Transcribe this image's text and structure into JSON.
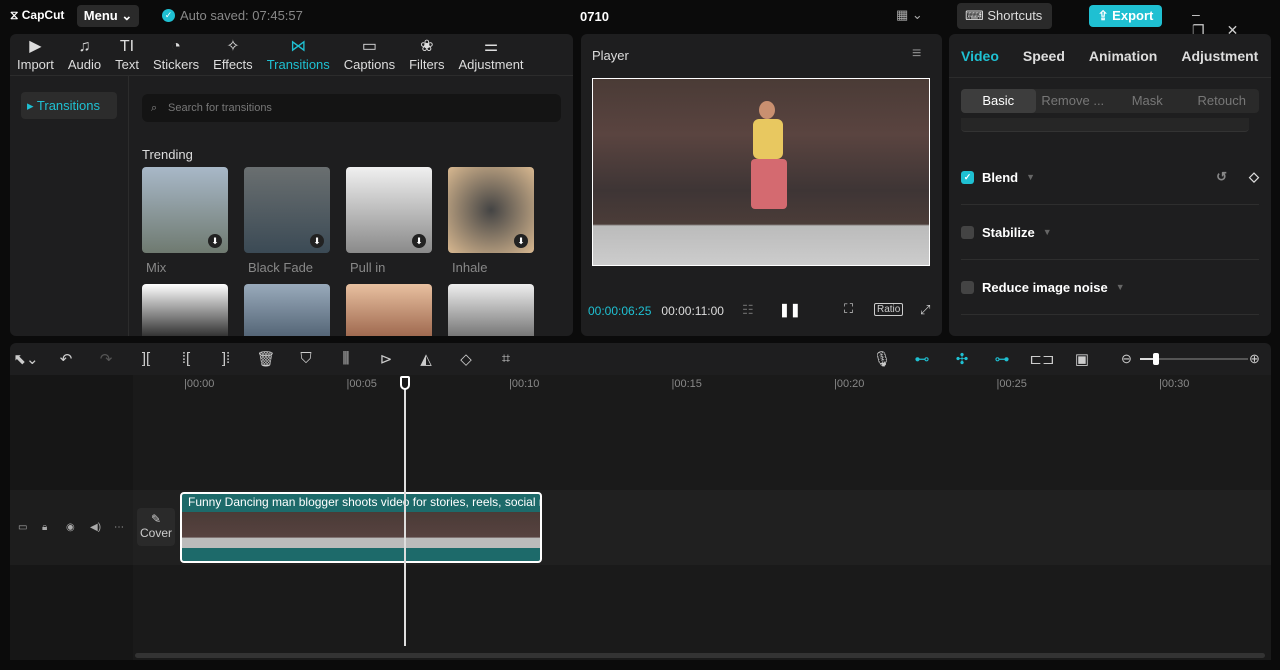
{
  "app": {
    "logo": "CapCut",
    "menu": "Menu",
    "autosave": "Auto saved: 07:45:57",
    "title": "0710",
    "shortcuts": "Shortcuts",
    "export": "Export"
  },
  "toolbar": [
    {
      "label": "Import",
      "icon": "▶"
    },
    {
      "label": "Audio",
      "icon": "♫"
    },
    {
      "label": "Text",
      "icon": "TI"
    },
    {
      "label": "Stickers",
      "icon": "◔"
    },
    {
      "label": "Effects",
      "icon": "✧"
    },
    {
      "label": "Transitions",
      "icon": "⋈"
    },
    {
      "label": "Captions",
      "icon": "▭"
    },
    {
      "label": "Filters",
      "icon": "❀"
    },
    {
      "label": "Adjustment",
      "icon": "⚌"
    }
  ],
  "sidebar": {
    "item": "Transitions"
  },
  "search": {
    "placeholder": "Search for transitions"
  },
  "trending": {
    "heading": "Trending",
    "items": [
      "Mix",
      "Black Fade",
      "Pull in",
      "Inhale"
    ]
  },
  "player": {
    "title": "Player",
    "current": "00:00:06:25",
    "total": "00:00:11:00",
    "ratio": "Ratio"
  },
  "right": {
    "tabs": [
      "Video",
      "Speed",
      "Animation",
      "Adjustment"
    ],
    "subtabs": [
      "Basic",
      "Remove ...",
      "Mask",
      "Retouch"
    ],
    "options": [
      {
        "label": "Blend",
        "checked": true
      },
      {
        "label": "Stabilize",
        "checked": false
      },
      {
        "label": "Reduce image noise",
        "checked": false
      }
    ]
  },
  "timeline": {
    "ticks": [
      "00:00",
      "00:05",
      "00:10",
      "00:15",
      "00:20",
      "00:25",
      "00:30"
    ],
    "clip_title": "Funny Dancing man blogger shoots video for stories, reels, social m",
    "cover": "Cover",
    "zoom_level": 0.15
  },
  "colors": {
    "accent": "#1fc0d2"
  }
}
